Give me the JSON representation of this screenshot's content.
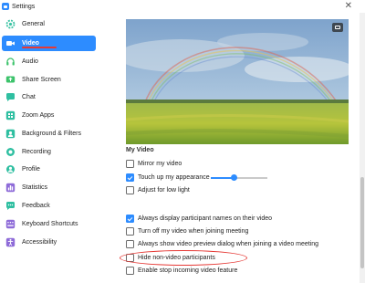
{
  "window": {
    "title": "Settings",
    "close_glyph": "✕"
  },
  "sidebar": {
    "items": [
      {
        "label": "General",
        "icon": "gear-icon",
        "color": "#3cc3a4"
      },
      {
        "label": "Video",
        "icon": "camera-icon",
        "color": "#ffffff",
        "active": true
      },
      {
        "label": "Audio",
        "icon": "headphones-icon",
        "color": "#3cc36b"
      },
      {
        "label": "Share Screen",
        "icon": "share-screen-icon",
        "color": "#3cc36b"
      },
      {
        "label": "Chat",
        "icon": "chat-icon",
        "color": "#2fbfa1"
      },
      {
        "label": "Zoom Apps",
        "icon": "zoom-apps-icon",
        "color": "#2fbfa1"
      },
      {
        "label": "Background & Filters",
        "icon": "background-icon",
        "color": "#2fbfa1"
      },
      {
        "label": "Recording",
        "icon": "recording-icon",
        "color": "#2fbfa1"
      },
      {
        "label": "Profile",
        "icon": "profile-icon",
        "color": "#2fbfa1"
      },
      {
        "label": "Statistics",
        "icon": "statistics-icon",
        "color": "#8e6bd8"
      },
      {
        "label": "Feedback",
        "icon": "feedback-icon",
        "color": "#2fbfa1"
      },
      {
        "label": "Keyboard Shortcuts",
        "icon": "keyboard-icon",
        "color": "#8e6bd8"
      },
      {
        "label": "Accessibility",
        "icon": "accessibility-icon",
        "color": "#8e6bd8"
      }
    ]
  },
  "video": {
    "section_title": "My Video",
    "my_video_options": [
      {
        "label": "Mirror my video",
        "checked": false
      },
      {
        "label": "Touch up my appearance",
        "checked": true
      },
      {
        "label": "Adjust for low light",
        "checked": false
      }
    ],
    "touch_up_level": 0.4,
    "meeting_options": [
      {
        "label": "Always display participant names on their video",
        "checked": true
      },
      {
        "label": "Turn off my video when joining meeting",
        "checked": false
      },
      {
        "label": "Always show video preview dialog when joining a video meeting",
        "checked": false
      },
      {
        "label": "Hide non-video participants",
        "checked": false,
        "highlighted": true
      },
      {
        "label": "Enable stop incoming video feature",
        "checked": false
      }
    ]
  },
  "colors": {
    "accent": "#2d8cff",
    "annotation": "#e53935"
  }
}
